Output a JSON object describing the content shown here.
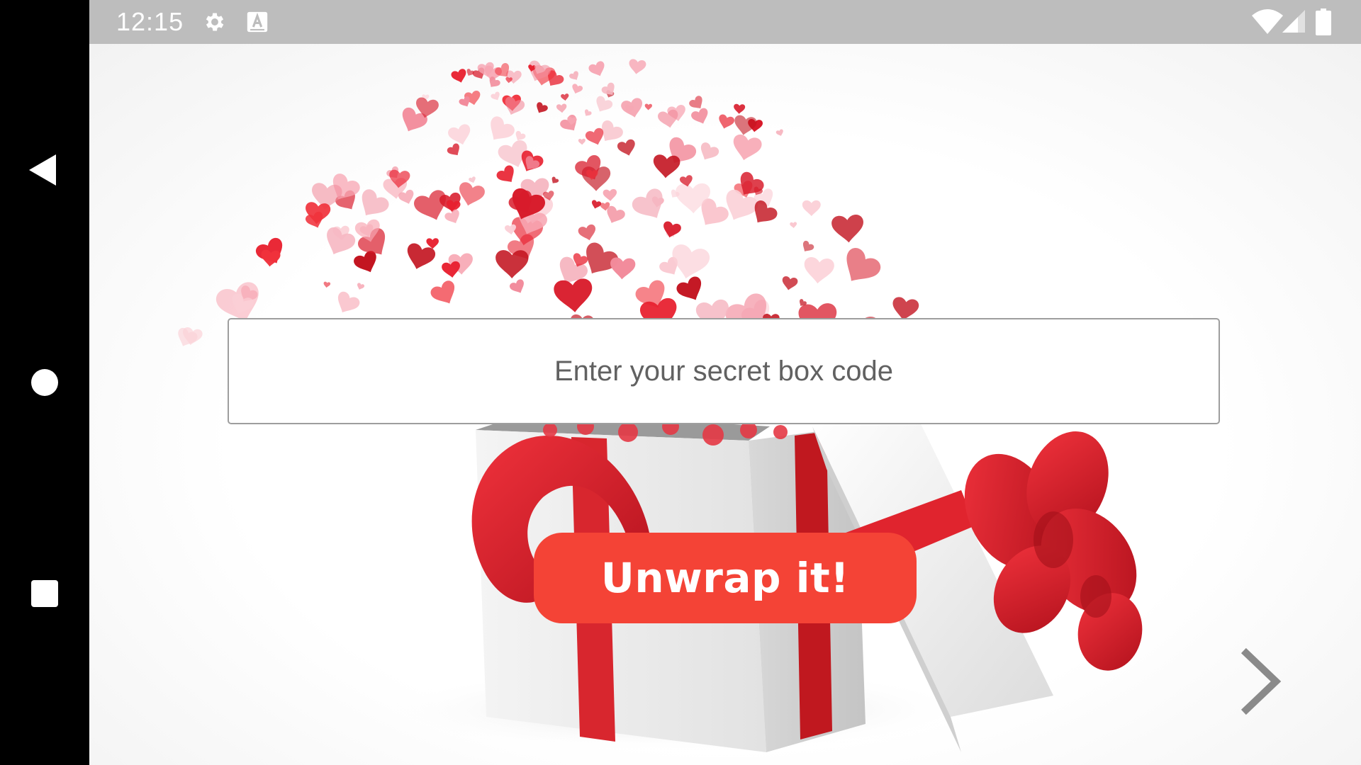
{
  "status_bar": {
    "time": "12:15",
    "left_icons": [
      "gear-icon",
      "text-a-icon"
    ],
    "right_icons": [
      "wifi-icon",
      "signal-icon",
      "battery-icon"
    ]
  },
  "navigation": {
    "back": "back-triangle-icon",
    "home": "home-circle-icon",
    "recents": "recents-square-icon"
  },
  "main": {
    "code_placeholder": "Enter your secret box code",
    "code_value": "",
    "unwrap_label": "Unwrap it!",
    "next_icon": "chevron-right-icon"
  },
  "colors": {
    "accent": "#f44336",
    "ribbon": "#d8262e",
    "heart_dark": "#d81b2b",
    "heart_light": "#f7a6b3",
    "status_bar": "#bdbdbd"
  }
}
